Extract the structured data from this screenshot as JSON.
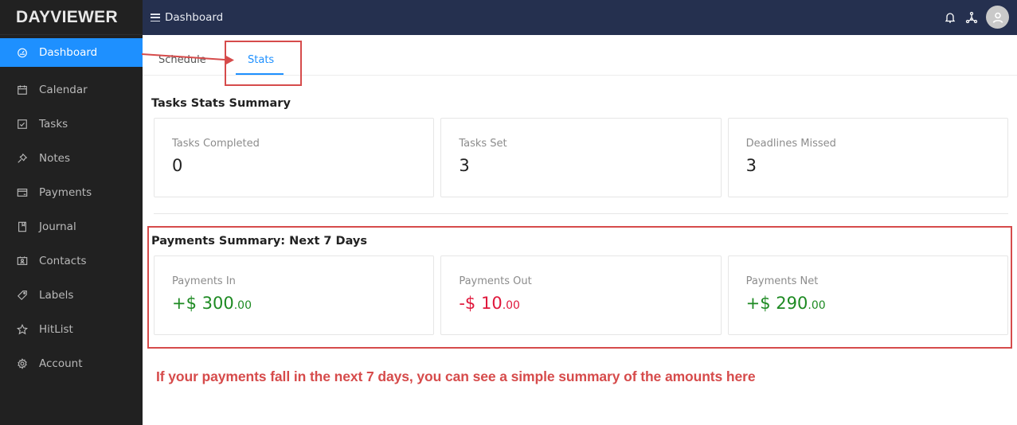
{
  "app": {
    "logo": "DAYVIEWER",
    "accent_color": "#1e90ff",
    "annotation_color": "#d64b4b"
  },
  "topbar": {
    "menu_icon": "hamburger-icon",
    "title": "Dashboard",
    "icons": [
      "bell-icon",
      "network-icon",
      "user-avatar-icon"
    ]
  },
  "sidebar": {
    "items": [
      {
        "label": "Dashboard",
        "icon": "dashboard-gauge-icon",
        "active": true
      },
      {
        "label": "Calendar",
        "icon": "calendar-icon"
      },
      {
        "label": "Tasks",
        "icon": "checkbox-icon"
      },
      {
        "label": "Notes",
        "icon": "pin-icon"
      },
      {
        "label": "Payments",
        "icon": "credit-card-icon"
      },
      {
        "label": "Journal",
        "icon": "book-icon"
      },
      {
        "label": "Contacts",
        "icon": "contact-card-icon"
      },
      {
        "label": "Labels",
        "icon": "tag-icon"
      },
      {
        "label": "HitList",
        "icon": "star-icon"
      },
      {
        "label": "Account",
        "icon": "gear-icon"
      }
    ]
  },
  "tabs": [
    {
      "label": "Schedule",
      "active": false
    },
    {
      "label": "Stats",
      "active": true
    }
  ],
  "tasks_summary": {
    "title": "Tasks Stats Summary",
    "cards": [
      {
        "label": "Tasks Completed",
        "value": "0"
      },
      {
        "label": "Tasks Set",
        "value": "3"
      },
      {
        "label": "Deadlines Missed",
        "value": "3"
      }
    ]
  },
  "payments_summary": {
    "title": "Payments Summary: Next 7 Days",
    "cards": [
      {
        "label": "Payments In",
        "sign": "+$ ",
        "whole": "300",
        "cents": ".00",
        "color": "#1d8a22"
      },
      {
        "label": "Payments Out",
        "sign": "-$ ",
        "whole": "10",
        "cents": ".00",
        "color": "#e0183c"
      },
      {
        "label": "Payments Net",
        "sign": "+$ ",
        "whole": "290",
        "cents": ".00",
        "color": "#1d8a22"
      }
    ]
  },
  "annotation": {
    "text": "If your payments fall in the next 7 days, you can see a simple summary of the amounts here"
  }
}
